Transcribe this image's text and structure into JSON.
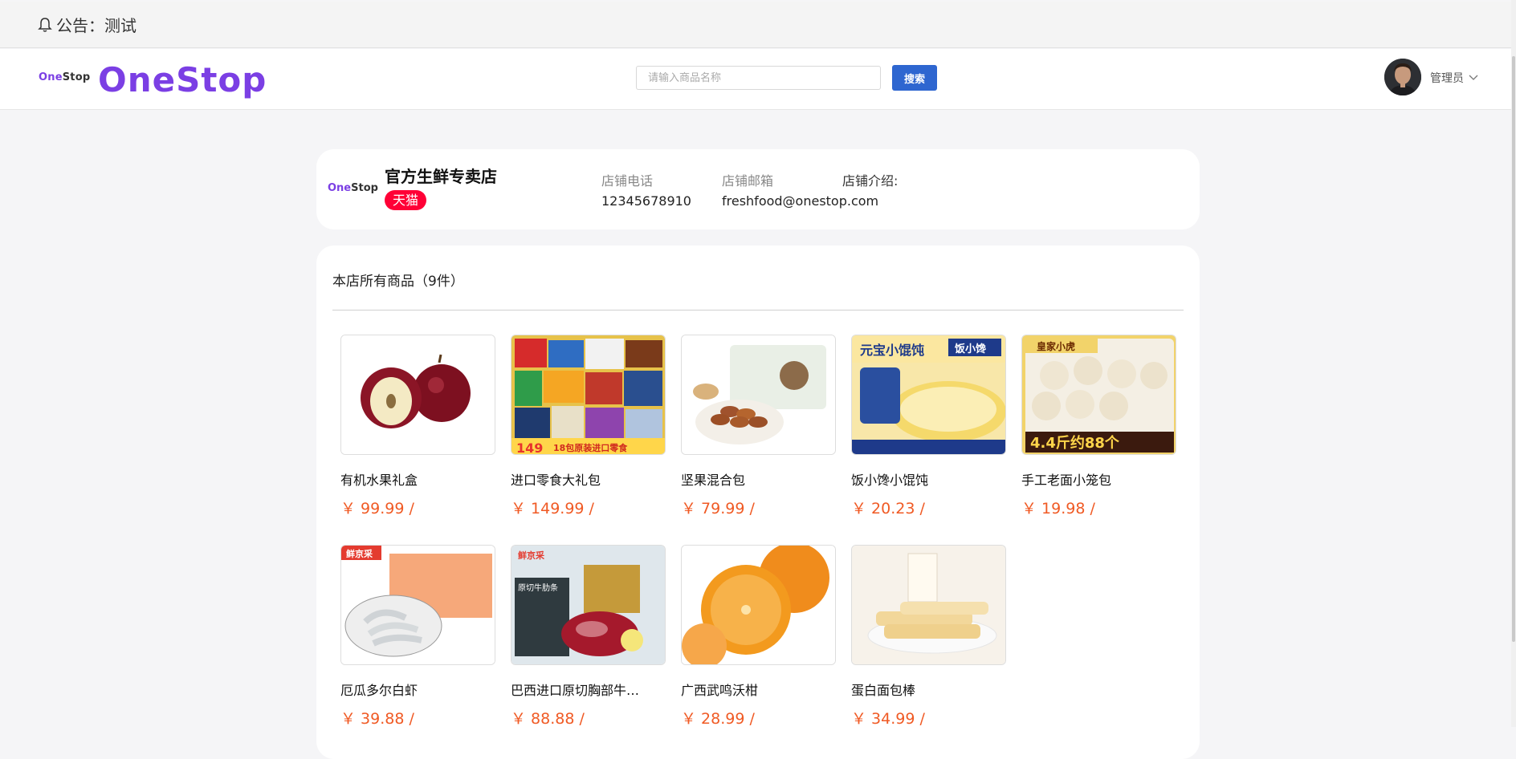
{
  "notice": {
    "text": "公告：测试",
    "icon": "bell-icon"
  },
  "header": {
    "logo_small_part1": "One",
    "logo_small_part2": "Stop",
    "logo_big": "OneStop",
    "search_placeholder": "请输入商品名称",
    "search_value": "",
    "search_button": "搜索",
    "user_name": "管理员",
    "accent_color": "#7b3fe4",
    "button_color": "#2e66d0"
  },
  "store": {
    "logo_part1": "One",
    "logo_part2": "Stop",
    "name": "官方生鲜专卖店",
    "badge": "天猫",
    "phone_label": "店铺电话",
    "phone": "12345678910",
    "email_label": "店铺邮箱",
    "email": "freshfood@onestop.com",
    "intro_label": "店铺介绍:"
  },
  "products": {
    "title": "本店所有商品（9件）",
    "price_color": "#f05a24",
    "items": [
      {
        "name": "有机水果礼盒",
        "price": "￥ 99.99 /"
      },
      {
        "name": "进口零食大礼包",
        "price": "￥ 149.99 /"
      },
      {
        "name": "坚果混合包",
        "price": "￥ 79.99 /"
      },
      {
        "name": "饭小馋小馄饨",
        "price": "￥ 20.23 /"
      },
      {
        "name": "手工老面小笼包",
        "price": "￥ 19.98 /"
      },
      {
        "name": "厄瓜多尔白虾",
        "price": "￥ 39.88 /"
      },
      {
        "name": "巴西进口原切胸部牛…",
        "price": "￥ 88.88 /"
      },
      {
        "name": "广西武鸣沃柑",
        "price": "￥ 28.99 /"
      },
      {
        "name": "蛋白面包棒",
        "price": "￥ 34.99 /"
      }
    ],
    "image_labels": {
      "snacks_price": "149",
      "snacks_banner": "18包原装进口零食",
      "wonton_title": "元宝小馄饨",
      "wonton_brand": "饭小馋",
      "bun_brand": "皇家小虎",
      "bun_weight": "4.4斤约88个",
      "shrimp_brand": "鲜京采",
      "beef_brand": "鲜京采",
      "beef_label": "原切牛肋条"
    }
  }
}
